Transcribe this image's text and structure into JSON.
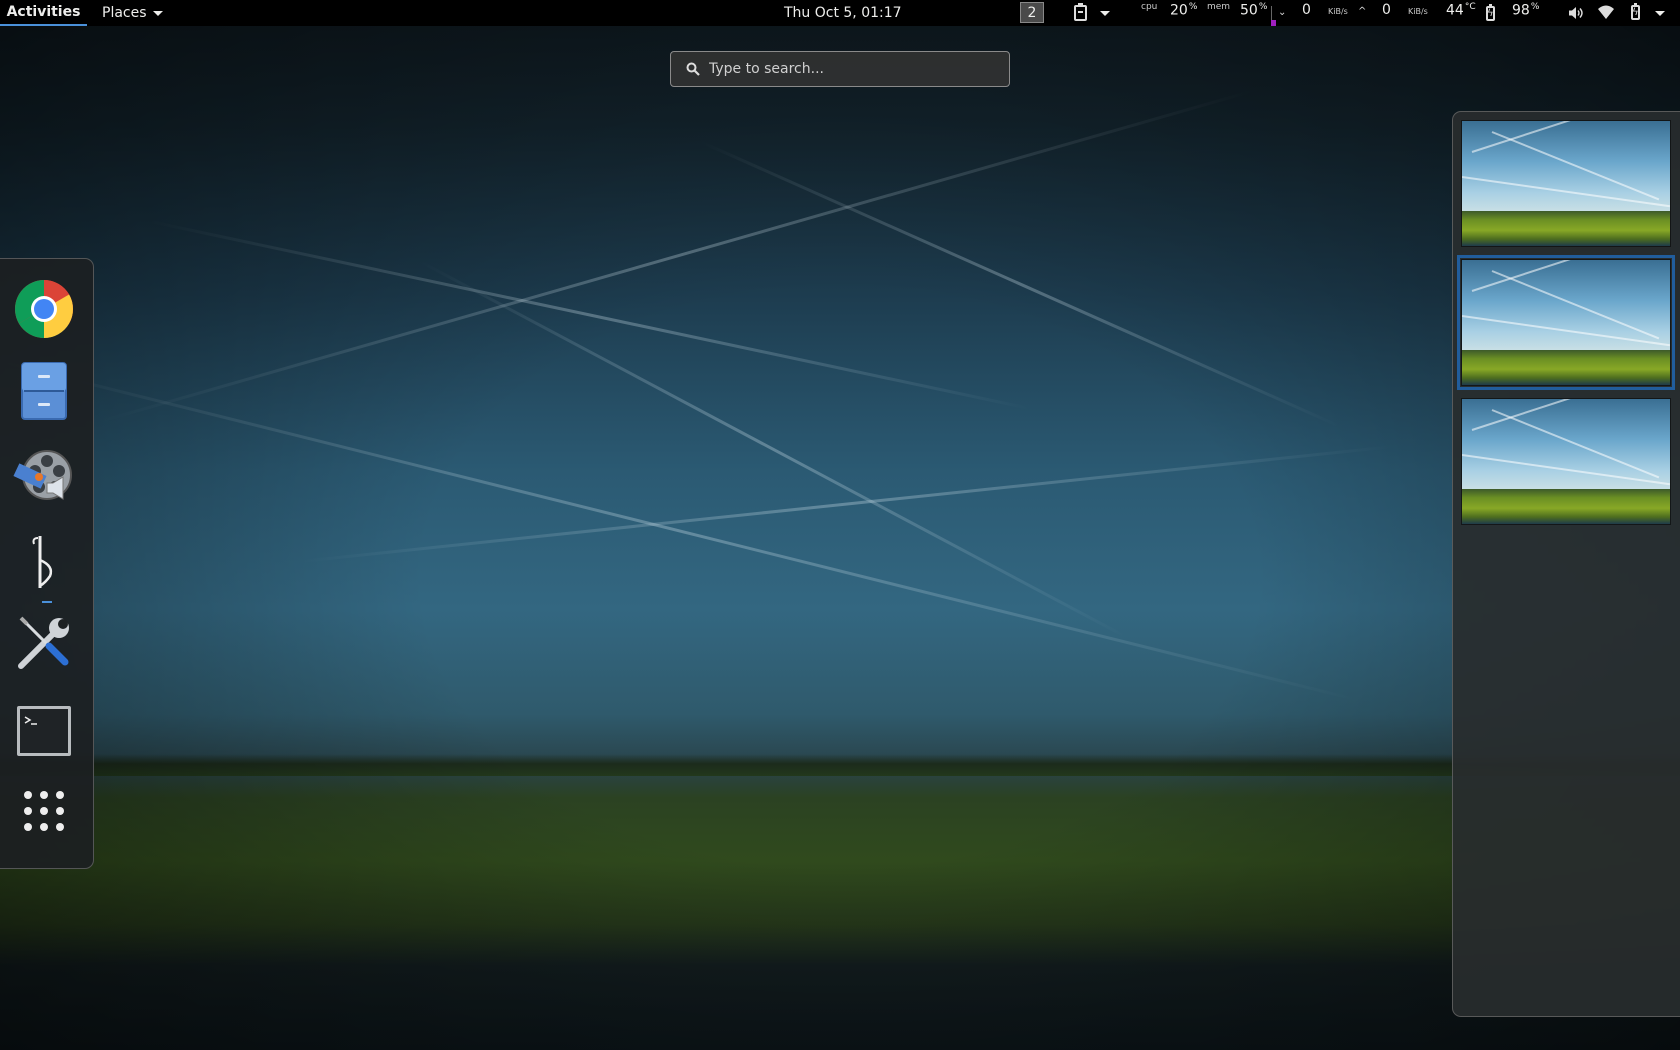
{
  "topbar": {
    "activities_label": "Activities",
    "places_label": "Places",
    "clock": "Thu Oct  5, 01:17",
    "workspace_number": "2",
    "monitor": {
      "cpu_label": "cpu",
      "cpu_value": "20",
      "mem_label": "mem",
      "mem_value": "50",
      "percent": "%",
      "down_value": "0",
      "down_unit": "KiB/s",
      "up_value": "0",
      "up_unit": "KiB/s",
      "temp_value": "44",
      "temp_unit": "°C",
      "battery_value": "98",
      "battery_unit": "%"
    }
  },
  "search": {
    "placeholder": "Type to search..."
  },
  "dash": {
    "apps": [
      {
        "name": "Google Chrome",
        "icon": "chrome-icon"
      },
      {
        "name": "Files",
        "icon": "file-cabinet-icon"
      },
      {
        "name": "Media Player",
        "icon": "film-reel-speaker-icon"
      },
      {
        "name": "Editor",
        "icon": "pen-nib-icon"
      },
      {
        "name": "Tweaks",
        "icon": "wrench-screwdriver-icon"
      },
      {
        "name": "Terminal",
        "icon": "terminal-icon"
      },
      {
        "name": "Show Applications",
        "icon": "app-grid-icon"
      }
    ]
  },
  "workspaces": {
    "count": 3,
    "active_index": 1
  },
  "colors": {
    "accent": "#4a90d9",
    "active_workspace_border": "#215d9c",
    "topbar": "#000000"
  }
}
